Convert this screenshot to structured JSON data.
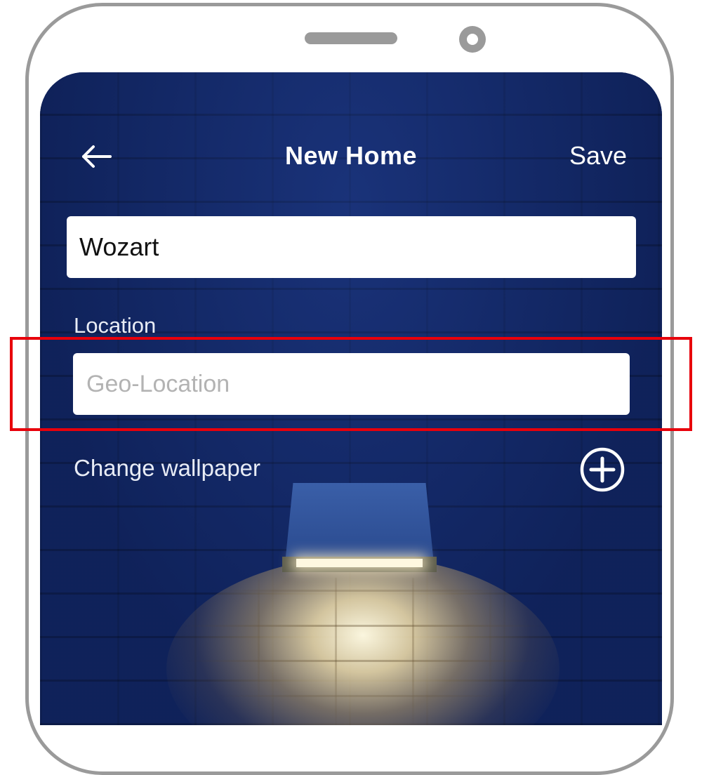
{
  "header": {
    "title": "New Home",
    "save_label": "Save",
    "back_icon": "back-arrow-icon"
  },
  "form": {
    "home_name_value": "Wozart",
    "location_label": "Location",
    "location_placeholder": "Geo-Location",
    "location_value": "",
    "wallpaper_label": "Change wallpaper",
    "add_icon": "plus-circle-icon"
  },
  "colors": {
    "wallpaper_blue": "#12286a",
    "text_white": "#ffffff",
    "highlight_red": "#e8000b",
    "phone_frame": "#9a9a9a"
  }
}
